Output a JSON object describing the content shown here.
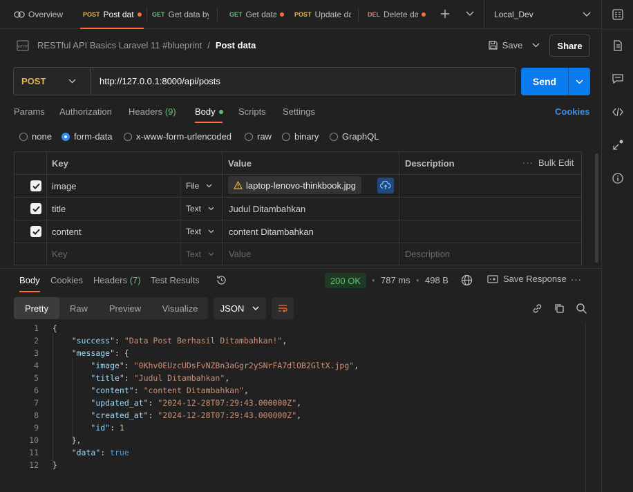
{
  "tabs": {
    "overview": "Overview",
    "items": [
      {
        "method": "POST",
        "label": "Post dat",
        "dirty": true
      },
      {
        "method": "GET",
        "label": "Get data by",
        "dirty": false
      },
      {
        "method": "GET",
        "label": "Get data",
        "dirty": true
      },
      {
        "method": "POST",
        "label": "Update da",
        "dirty": false
      },
      {
        "method": "DEL",
        "label": "Delete dat",
        "dirty": true
      }
    ],
    "environment": "Local_Dev"
  },
  "breadcrumb": {
    "collection": "RESTful API Basics Laravel 11 #blueprint",
    "separator": "/",
    "current": "Post data"
  },
  "header": {
    "save_label": "Save",
    "share_label": "Share"
  },
  "request": {
    "method": "POST",
    "url": "http://127.0.0.1:8000/api/posts",
    "send_label": "Send"
  },
  "request_tabs": {
    "params": "Params",
    "authorization": "Authorization",
    "headers": "Headers",
    "headers_count": "(9)",
    "body": "Body",
    "scripts": "Scripts",
    "settings": "Settings",
    "cookies": "Cookies"
  },
  "body_modes": {
    "options": [
      "none",
      "form-data",
      "x-www-form-urlencoded",
      "raw",
      "binary",
      "GraphQL"
    ],
    "selected": "form-data"
  },
  "form_table": {
    "headers": {
      "key": "Key",
      "value": "Value",
      "description": "Description",
      "bulk_edit": "Bulk Edit"
    },
    "rows": [
      {
        "checked": true,
        "key": "image",
        "type": "File",
        "value": "laptop-lenovo-thinkbook.jpg",
        "description": ""
      },
      {
        "checked": true,
        "key": "title",
        "type": "Text",
        "value": "Judul Ditambahkan",
        "description": ""
      },
      {
        "checked": true,
        "key": "content",
        "type": "Text",
        "value": "content Ditambahkan",
        "description": ""
      }
    ],
    "placeholder": {
      "key": "Key",
      "type": "Text",
      "value": "Value",
      "description": "Description"
    }
  },
  "response": {
    "tabs": {
      "body": "Body",
      "cookies": "Cookies",
      "headers": "Headers",
      "headers_count": "(7)",
      "tests": "Test Results"
    },
    "status": "200 OK",
    "time": "787 ms",
    "size": "498 B",
    "save_label": "Save Response",
    "views": [
      "Pretty",
      "Raw",
      "Preview",
      "Visualize"
    ],
    "active_view": "Pretty",
    "format": "JSON"
  },
  "json_lines": [
    "1",
    "2",
    "3",
    "4",
    "5",
    "6",
    "7",
    "8",
    "9",
    "10",
    "11",
    "12"
  ],
  "json_body": {
    "success_key": "\"success\"",
    "success_val": "\"Data Post Berhasil Ditambahkan!\"",
    "message_key": "\"message\"",
    "image_key": "\"image\"",
    "image_val": "\"0Khv0EUzcUDsFvNZBn3aGgr2ySNrFA7dlOB2GltX.jpg\"",
    "title_key": "\"title\"",
    "title_val": "\"Judul Ditambahkan\"",
    "content_key": "\"content\"",
    "content_val": "\"content Ditambahkan\"",
    "updated_key": "\"updated_at\"",
    "updated_val": "\"2024-12-28T07:29:43.000000Z\"",
    "created_key": "\"created_at\"",
    "created_val": "\"2024-12-28T07:29:43.000000Z\"",
    "id_key": "\"id\"",
    "id_val": "1",
    "data_key": "\"data\"",
    "data_val": "true"
  },
  "colors": {
    "accent": "#097bed",
    "status_ok": "#6bbd76",
    "orange": "#ff6c37",
    "background": "#212121"
  }
}
